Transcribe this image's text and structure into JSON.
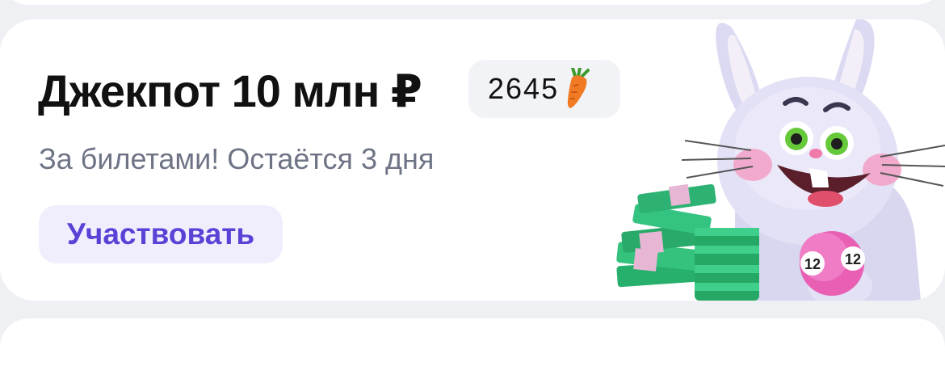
{
  "jackpot_card": {
    "title": "Джекпот 10 млн ₽",
    "carrot_balance": "2645",
    "balance_icon": "carrot-icon",
    "subtitle": "За билетами! Остаётся 3 дня",
    "cta_label": "Участвовать",
    "illustration": "rabbit-with-money-illustration",
    "lottery_ball_numbers": [
      "12",
      "12"
    ]
  },
  "colors": {
    "page_background": "#eef0f4",
    "card_background": "#ffffff",
    "title": "#111111",
    "subtitle": "#6e7485",
    "cta_background": "#f0eefd",
    "cta_text": "#5b41d6",
    "pill_background": "#f2f3f6"
  }
}
